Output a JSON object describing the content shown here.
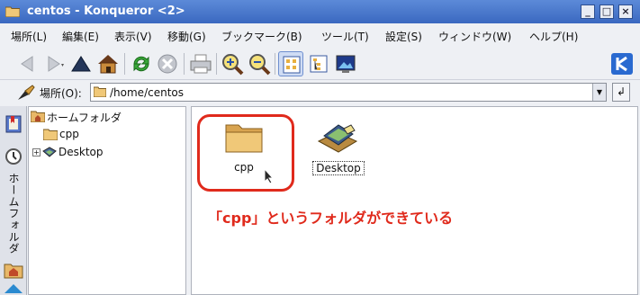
{
  "window": {
    "title": "centos - Konqueror <2>",
    "controls": {
      "minimize": "_",
      "maximize": "□",
      "close": "×"
    }
  },
  "menubar": {
    "items": [
      "場所(L)",
      "編集(E)",
      "表示(V)",
      "移動(G)",
      "ブックマーク(B)",
      "ツール(T)",
      "設定(S)",
      "ウィンドウ(W)",
      "ヘルプ(H)"
    ]
  },
  "toolbar": {
    "buttons": [
      "back-icon",
      "forward-icon",
      "up-icon",
      "home-icon",
      "reload-icon",
      "stop-icon",
      "print-icon",
      "zoom-in-icon",
      "zoom-out-icon",
      "icon-view-icon",
      "tree-view-icon",
      "image-view-icon",
      "kde-logo-icon"
    ]
  },
  "location": {
    "label": "場所(O):",
    "value": "/home/centos",
    "go": "↲"
  },
  "sidebar": {
    "vertical_label": "ホームフォルダ"
  },
  "tree": {
    "root": "ホームフォルダ",
    "children": [
      {
        "label": "cpp",
        "expander": ""
      },
      {
        "label": "Desktop",
        "expander": "+"
      }
    ]
  },
  "main": {
    "items": [
      {
        "label": "cpp",
        "icon": "folder-icon"
      },
      {
        "label": "Desktop",
        "icon": "desktop-folder-icon"
      }
    ],
    "annotation": "「cpp」というフォルダができている"
  },
  "colors": {
    "titlebar": "#3a68c0",
    "annotation": "#e02a1c",
    "folder": "#e8b868"
  }
}
